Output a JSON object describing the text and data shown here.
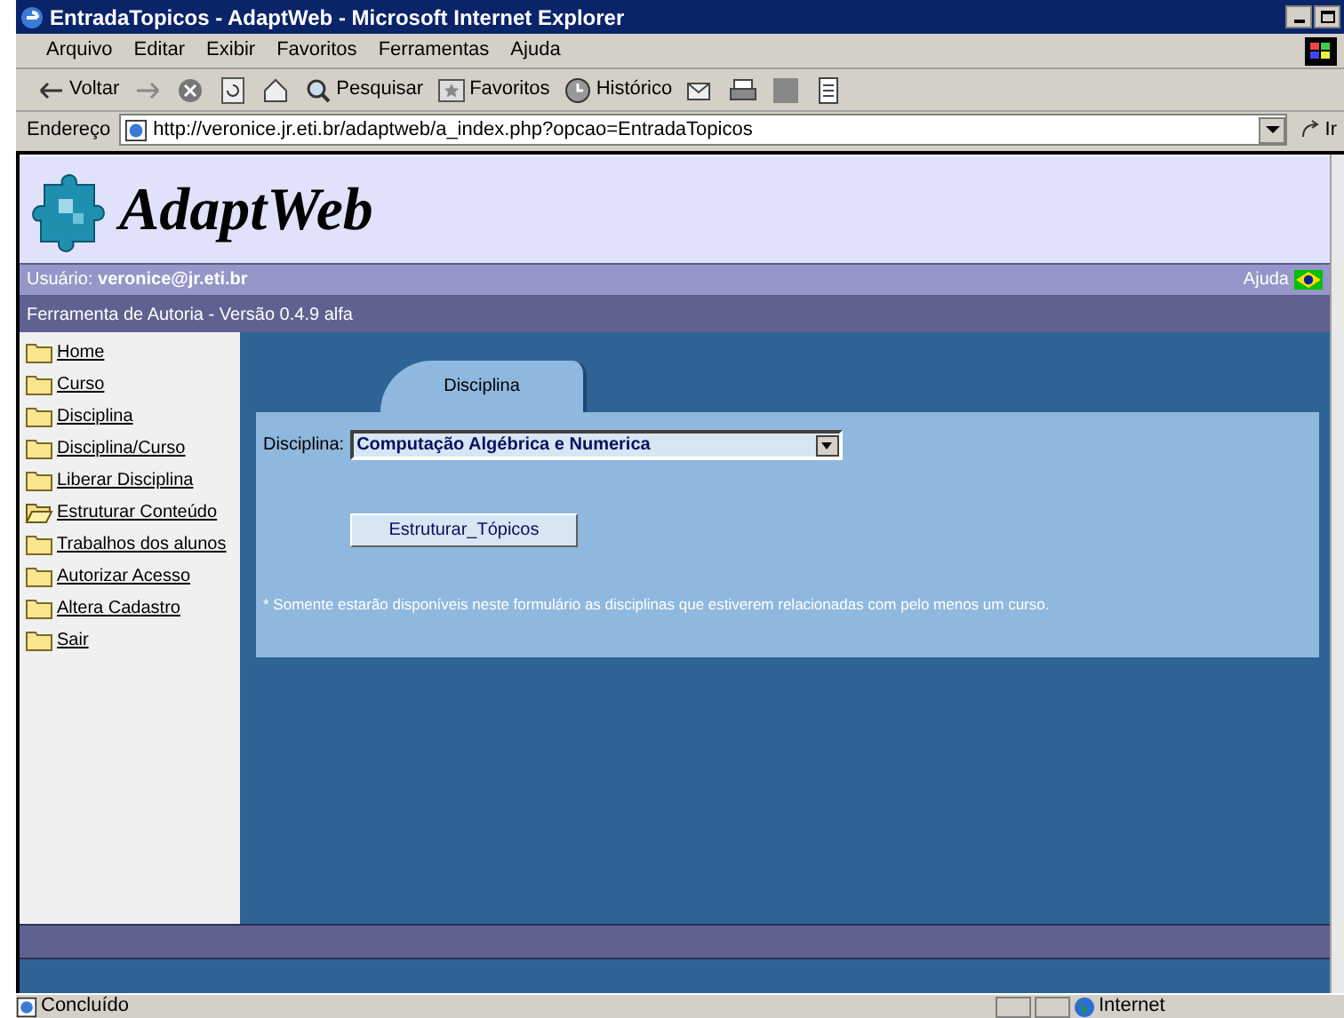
{
  "window": {
    "title": "EntradaTopicos - AdaptWeb - Microsoft Internet Explorer"
  },
  "menu": [
    "Arquivo",
    "Editar",
    "Exibir",
    "Favoritos",
    "Ferramentas",
    "Ajuda"
  ],
  "toolbar": [
    {
      "kind": "back",
      "label": "Voltar"
    },
    {
      "kind": "forward"
    },
    {
      "kind": "stop"
    },
    {
      "kind": "refresh"
    },
    {
      "kind": "home"
    },
    {
      "kind": "search",
      "label": "Pesquisar"
    },
    {
      "kind": "favorites",
      "label": "Favoritos"
    },
    {
      "kind": "history",
      "label": "Histórico"
    },
    {
      "kind": "mail"
    },
    {
      "kind": "print"
    },
    {
      "kind": "edit"
    },
    {
      "kind": "discuss"
    }
  ],
  "address": {
    "label": "Endereço",
    "value": "http://veronice.jr.eti.br/adaptweb/a_index.php?opcao=EntradaTopicos",
    "go": "Ir"
  },
  "page": {
    "logo": "AdaptWeb",
    "user_label": "Usuário:",
    "user": "veronice@jr.eti.br",
    "help": "Ajuda",
    "version": "Ferramenta de Autoria - Versão 0.4.9 alfa",
    "sidebar": [
      {
        "label": "Home",
        "open": false
      },
      {
        "label": "Curso",
        "open": false
      },
      {
        "label": "Disciplina",
        "open": false
      },
      {
        "label": "Disciplina/Curso",
        "open": false
      },
      {
        "label": "Liberar Disciplina",
        "open": false
      },
      {
        "label": "Estruturar Conteúdo",
        "open": true
      },
      {
        "label": "Trabalhos dos alunos",
        "open": false
      },
      {
        "label": "Autorizar Acesso",
        "open": false
      },
      {
        "label": "Altera Cadastro",
        "open": false
      },
      {
        "label": "Sair",
        "open": false
      }
    ],
    "tab": {
      "label": "Disciplina",
      "selected": true
    },
    "field_label": "Disciplina:",
    "field_value": "Computação Algébrica e Numerica",
    "button": "Estruturar_Tópicos",
    "note": "* Somente estarão disponíveis neste formulário as disciplinas que estiverem relacionadas com pelo menos um curso."
  },
  "status_bar": {
    "text": "Concluído",
    "zone": "Internet"
  }
}
